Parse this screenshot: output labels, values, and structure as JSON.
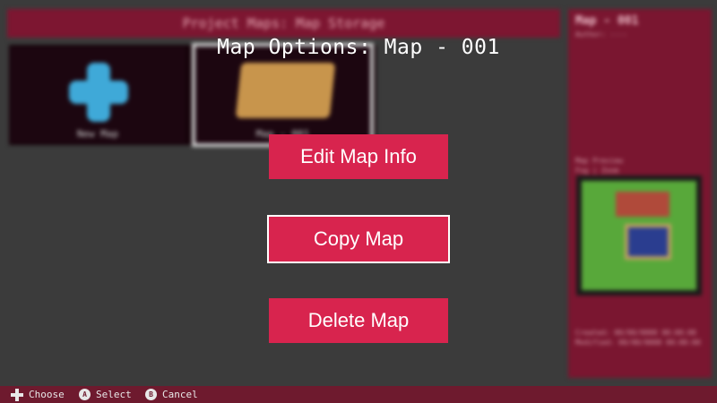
{
  "background": {
    "header_title": "Project Maps: Map Storage",
    "tiles": [
      {
        "label": "New Map",
        "icon": "plus-icon"
      },
      {
        "label": "Map - 001",
        "icon": "scroll-icon"
      }
    ],
    "side_panel": {
      "title": "Map - 001",
      "subtitle": "Author: ----",
      "preview_label": "Map Preview",
      "legend": "Fog | Zoom",
      "dates": "Created: 00/00/0000 00:00:00  Modified: 00/00/0000 00:00:00"
    }
  },
  "dialog": {
    "title": "Map Options: Map - 001",
    "options": [
      {
        "label": "Edit Map Info",
        "selected": false
      },
      {
        "label": "Copy Map",
        "selected": true
      },
      {
        "label": "Delete Map",
        "selected": false
      }
    ]
  },
  "footer": {
    "hints": [
      {
        "icon": "dpad-icon",
        "label": "Choose"
      },
      {
        "icon": "a-button-icon",
        "glyph": "A",
        "label": "Select"
      },
      {
        "icon": "b-button-icon",
        "glyph": "B",
        "label": "Cancel"
      }
    ]
  },
  "colors": {
    "accent": "#d8244e",
    "panel": "#7a1630",
    "background": "#3b3b3b",
    "footer": "#6e1a2e"
  }
}
